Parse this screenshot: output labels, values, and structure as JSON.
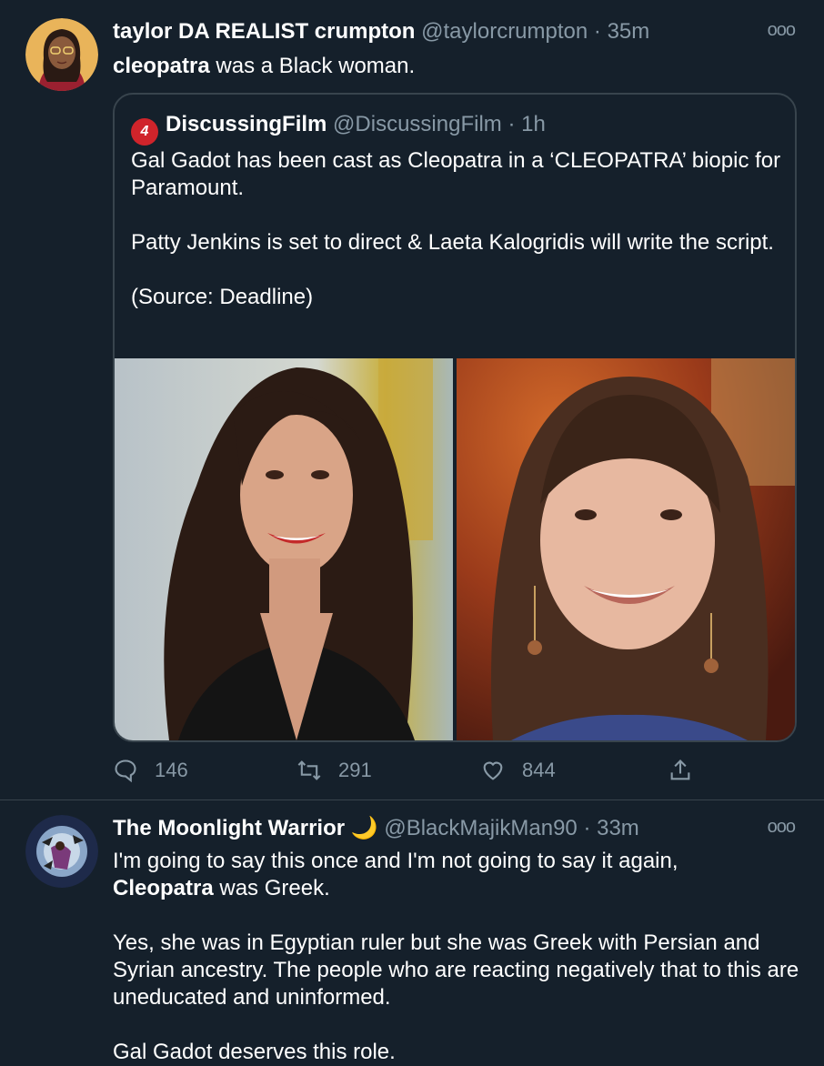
{
  "tweet1": {
    "name": "taylor DA REALIST crumpton",
    "handle": "@taylorcrumpton",
    "dot": "·",
    "time": "35m",
    "more": "ooo",
    "text_bold": "cleopatra",
    "text_rest": " was a Black woman.",
    "quote": {
      "name": "DiscussingFilm",
      "handle": "@DiscussingFilm",
      "dot": "·",
      "time": "1h",
      "logo_glyph": "4",
      "para1": "Gal Gadot has been cast as Cleopatra in a ‘CLEOPATRA’ biopic for Paramount.",
      "para2": "Patty Jenkins is set to direct & Laeta Kalogridis will write the script.",
      "para3": "(Source: Deadline)"
    },
    "actions": {
      "reply_count": "146",
      "retweet_count": "291",
      "like_count": "844"
    }
  },
  "tweet2": {
    "name": "The Moonlight Warrior",
    "emoji": "🌙",
    "handle": "@BlackMajikMan90",
    "dot": "·",
    "time": "33m",
    "more": "ooo",
    "line1": "I'm going to say this once and I'm not going to say it again,",
    "line2_bold": "Cleopatra",
    "line2_rest": " was Greek.",
    "para2": "Yes, she was in Egyptian ruler but she was Greek with Persian and Syrian ancestry. The people who are reacting negatively that to this are uneducated and uninformed.",
    "para3": "Gal Gadot deserves this role."
  },
  "colors": {
    "background": "#15202b",
    "border": "#38444d",
    "secondary_text": "#8899a6",
    "logo_red": "#d0242b"
  },
  "icons": [
    "reply-icon",
    "retweet-icon",
    "like-icon",
    "share-icon",
    "more-icon"
  ]
}
